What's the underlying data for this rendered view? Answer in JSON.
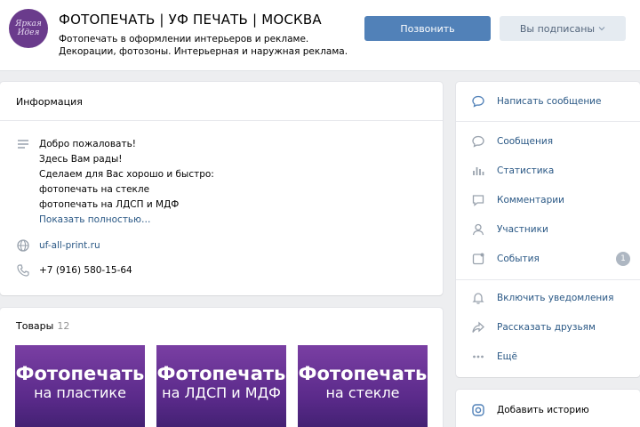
{
  "header": {
    "avatar_line1": "Яркая",
    "avatar_line2": "Идея",
    "title": "ФОТОПЕЧАТЬ | УФ ПЕЧАТЬ | МОСКВА",
    "desc_line1": "Фотопечать в оформлении интерьеров и рекламе.",
    "desc_line2": "Декорации, фотозоны. Интерьерная и наружная реклама.",
    "call_button": "Позвонить",
    "subscribed_button": "Вы подписаны"
  },
  "info": {
    "heading": "Информация",
    "lines": [
      "Добро пожаловать!",
      "Здесь Вам рады!",
      "Сделаем для Вас хорошо и быстро:",
      "фотопечать на стекле",
      "фотопечать на ЛДСП и МДФ"
    ],
    "show_more": "Показать полностью…",
    "website": "uf-all-print.ru",
    "phone": "+7 (916) 580-15-64"
  },
  "goods": {
    "heading": "Товары",
    "count": "12",
    "items": [
      {
        "line1": "Фотопечать",
        "line2": "на пластике"
      },
      {
        "line1": "Фотопечать",
        "line2": "на ЛДСП и МДФ"
      },
      {
        "line1": "Фотопечать",
        "line2": "на стекле"
      }
    ]
  },
  "menu": {
    "write_message": "Написать сообщение",
    "messages": "Сообщения",
    "statistics": "Статистика",
    "comments": "Комментарии",
    "members": "Участники",
    "events": "События",
    "events_badge": "1",
    "enable_notifications": "Включить уведомления",
    "tell_friends": "Рассказать друзьям",
    "more": "Ещё",
    "add_story": "Добавить историю"
  },
  "colors": {
    "accent": "#5181b8",
    "link": "#2a5885",
    "background": "#edeef0"
  }
}
